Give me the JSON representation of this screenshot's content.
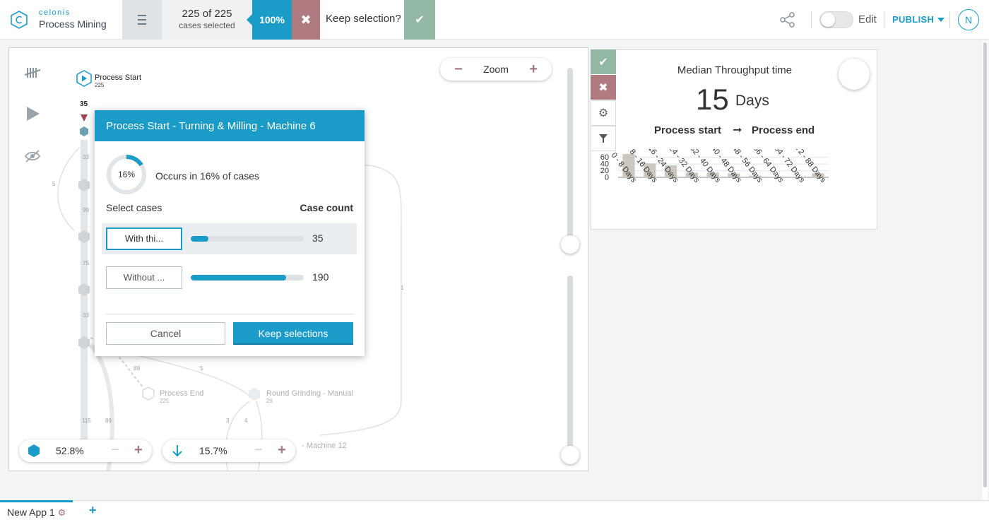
{
  "header": {
    "brand_top": "celonis",
    "brand_bottom": "Process Mining",
    "case_count": "225 of 225",
    "case_label": "cases selected",
    "selection_percent": "100%",
    "remove_symbol": "✖",
    "keep_question": "Keep selection?",
    "confirm_symbol": "✔",
    "edit_label": "Edit",
    "publish_label": "PUBLISH",
    "avatar_initial": "N",
    "icons": [
      "celonis-logo-icon",
      "menu-icon",
      "share-icon",
      "chevron-down-icon"
    ]
  },
  "map": {
    "zoom_label": "Zoom",
    "zoom_minus": "−",
    "zoom_plus": "+",
    "start_node": {
      "label": "Process Start",
      "count": "225"
    },
    "first_edge_count": "35",
    "end_node": {
      "label": "Process End",
      "count": "225"
    },
    "grinding_node": {
      "label": "Round Grinding - Manual",
      "count": "26"
    },
    "machine12_label": "- Machine 12",
    "edge_numbers": {
      "e33a": "33",
      "e5a": "5",
      "e99": "99",
      "e75": "75",
      "e33b": "33",
      "e89a": "89",
      "e5b": "5",
      "e115": "115",
      "e89b": "89",
      "e3": "3",
      "e4": "4",
      "e1": "1"
    },
    "activity_slider": {
      "value": "52.8%",
      "minus": "−",
      "plus": "+"
    },
    "connection_slider": {
      "value": "15.7%",
      "minus": "−",
      "plus": "+"
    },
    "icons": [
      "tally-icon",
      "play-icon",
      "eye-off-icon",
      "hexagon-icon",
      "arrow-down-icon"
    ]
  },
  "popup": {
    "title": "Process Start - Turning & Milling - Machine 6",
    "donut_percent": "16%",
    "donut_fraction": 0.16,
    "occurs_text": "Occurs in 16% of cases",
    "select_cases_label": "Select cases",
    "case_count_header": "Case count",
    "options": [
      {
        "label": "With thi...",
        "count": "35",
        "fraction": 0.156
      },
      {
        "label": "Without ...",
        "count": "190",
        "fraction": 0.844
      }
    ],
    "cancel_label": "Cancel",
    "keep_label": "Keep selections"
  },
  "kpi": {
    "title": "Median Throughput time",
    "value": "15",
    "unit": "Days",
    "from_label": "Process start",
    "arrow": "➞",
    "to_label": "Process end",
    "toolbar": {
      "check": "✔",
      "close": "✖",
      "gear": "⚙",
      "filter": "filter-icon"
    }
  },
  "chart_data": {
    "type": "bar",
    "categories": [
      "0 - 8 Days",
      "8 - 16 Days",
      "16 - 24 Days",
      "24 - 32 Days",
      "32 - 40 Days",
      "40 - 48 Days",
      "48 - 56 Days",
      "56 - 64 Days",
      "64 - 72 Days",
      "72 - 88 Days"
    ],
    "values": [
      70,
      42,
      36,
      14,
      14,
      12,
      5,
      2,
      2,
      12
    ],
    "yticks": [
      "60",
      "40",
      "20",
      "0"
    ],
    "ylim": [
      0,
      70
    ],
    "grid": true,
    "bar_color": "#cbc8c0"
  },
  "footer": {
    "app_tab": "New App 1",
    "add_symbol": "+"
  }
}
